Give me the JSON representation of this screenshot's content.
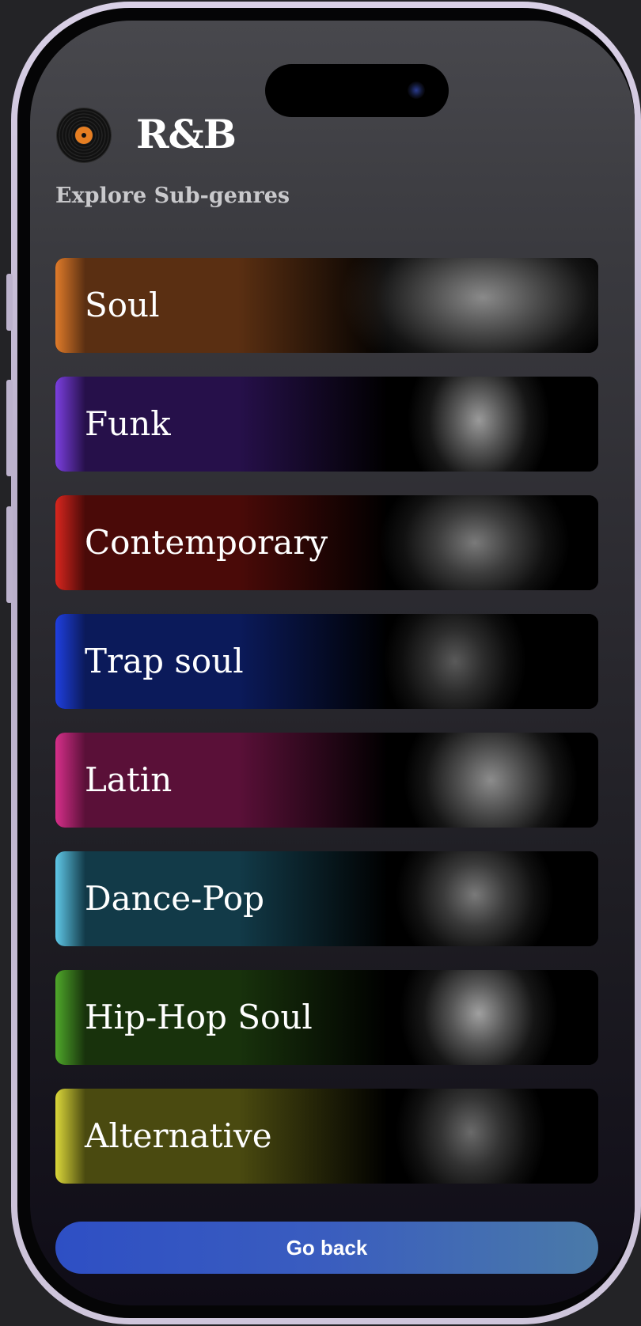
{
  "header": {
    "title": "R&B",
    "subtitle": "Explore Sub-genres",
    "icon": "vinyl-record-icon"
  },
  "genres": [
    {
      "label": "Soul",
      "accent": "#e07b2a",
      "tint": "#5a2f12"
    },
    {
      "label": "Funk",
      "accent": "#7b3fe0",
      "tint": "#26104a"
    },
    {
      "label": "Contemporary",
      "accent": "#d8261e",
      "tint": "#4a0a08"
    },
    {
      "label": "Trap soul",
      "accent": "#1f3fe0",
      "tint": "#0b1a5a"
    },
    {
      "label": "Latin",
      "accent": "#d62f8a",
      "tint": "#5a1038"
    },
    {
      "label": "Dance-Pop",
      "accent": "#5fc8e8",
      "tint": "#123a48"
    },
    {
      "label": "Hip-Hop Soul",
      "accent": "#4fa82a",
      "tint": "#18320c"
    },
    {
      "label": "Alternative",
      "accent": "#dcd83a",
      "tint": "#4a4a10"
    }
  ],
  "footer": {
    "go_back_label": "Go back"
  }
}
